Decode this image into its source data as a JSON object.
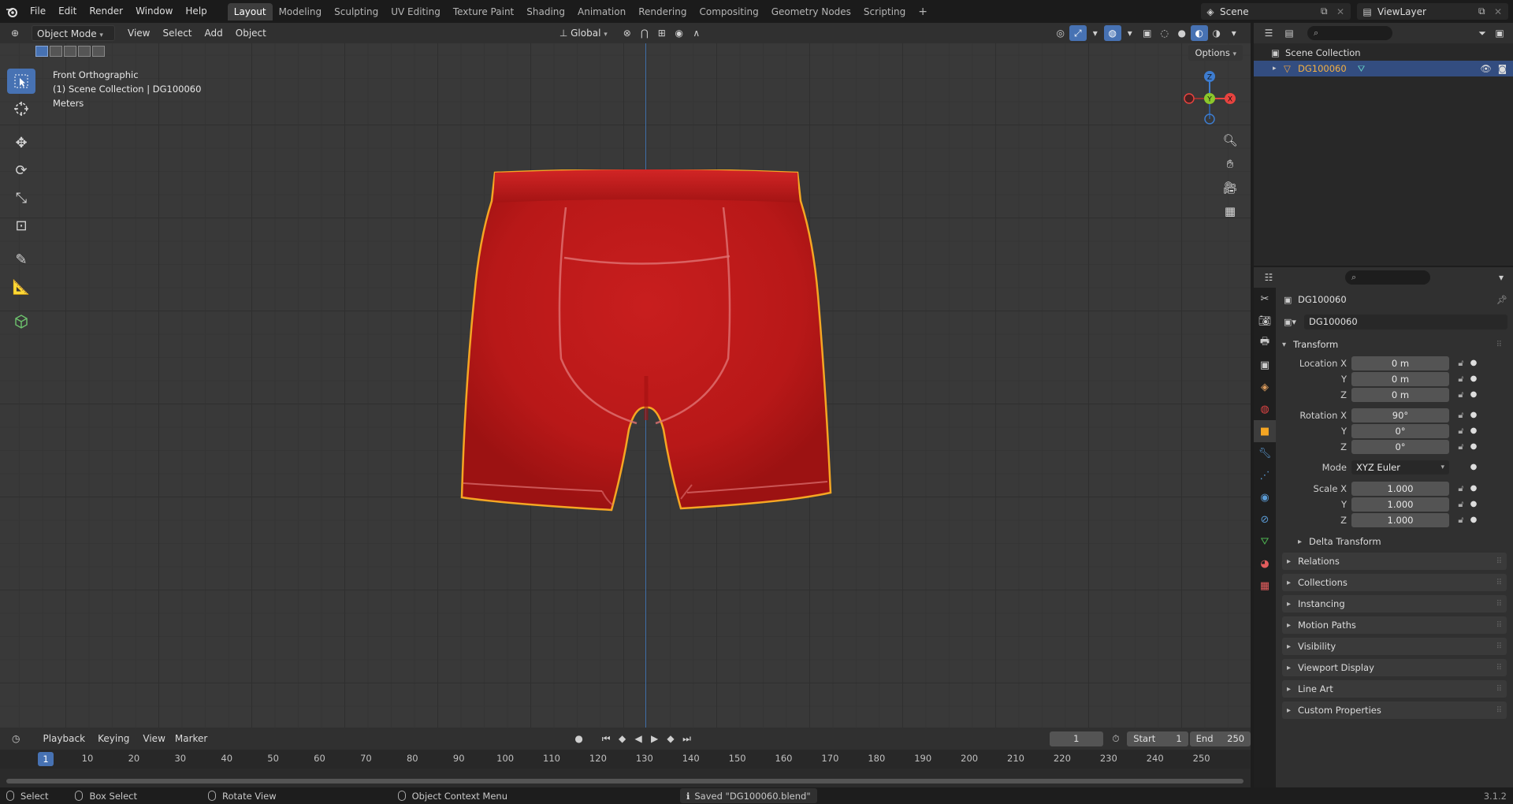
{
  "menu": [
    "File",
    "Edit",
    "Render",
    "Window",
    "Help"
  ],
  "workspaces": [
    "Layout",
    "Modeling",
    "Sculpting",
    "UV Editing",
    "Texture Paint",
    "Shading",
    "Animation",
    "Rendering",
    "Compositing",
    "Geometry Nodes",
    "Scripting"
  ],
  "active_workspace": "Layout",
  "scene": {
    "name": "Scene"
  },
  "view_layer": {
    "name": "ViewLayer"
  },
  "viewport_header": {
    "mode": "Object Mode",
    "menus": [
      "View",
      "Select",
      "Add",
      "Object"
    ],
    "orientation": "Global",
    "options": "Options"
  },
  "viewport_info": {
    "view": "Front Orthographic",
    "collection": "(1) Scene Collection | DG100060",
    "units": "Meters"
  },
  "gizmo": {
    "z": "Z",
    "y": "Y",
    "x": "X"
  },
  "outliner": {
    "root": "Scene Collection",
    "object": "DG100060"
  },
  "properties": {
    "object_name": "DG100060",
    "data_name": "DG100060",
    "transform_title": "Transform",
    "location": {
      "label": "Location X",
      "x": "0 m",
      "y": "0 m",
      "z": "0 m"
    },
    "rotation": {
      "label": "Rotation X",
      "x": "90°",
      "y": "0°",
      "z": "0°"
    },
    "mode_label": "Mode",
    "mode_value": "XYZ Euler",
    "scale": {
      "label": "Scale X",
      "x": "1.000",
      "y": "1.000",
      "z": "1.000"
    },
    "axis_y": "Y",
    "axis_z": "Z",
    "delta": "Delta Transform",
    "panels": [
      "Relations",
      "Collections",
      "Instancing",
      "Motion Paths",
      "Visibility",
      "Viewport Display",
      "Line Art",
      "Custom Properties"
    ]
  },
  "timeline": {
    "menus": [
      "Playback",
      "Keying",
      "View",
      "Marker"
    ],
    "current_frame": "1",
    "start_label": "Start",
    "start": "1",
    "end_label": "End",
    "end": "250",
    "ticks": [
      "1",
      "10",
      "20",
      "30",
      "40",
      "50",
      "60",
      "70",
      "80",
      "90",
      "100",
      "110",
      "120",
      "130",
      "140",
      "150",
      "160",
      "170",
      "180",
      "190",
      "200",
      "210",
      "220",
      "230",
      "240",
      "250"
    ]
  },
  "statusbar": {
    "select": "Select",
    "box_select": "Box Select",
    "rotate_view": "Rotate View",
    "context_menu": "Object Context Menu",
    "message": "Saved \"DG100060.blend\"",
    "version": "3.1.2"
  },
  "colors": {
    "accent": "#4772b3",
    "mesh": "#c8191b",
    "outline": "#f5a623",
    "x_axis": "#e8433f",
    "y_axis": "#8bc72b",
    "z_axis": "#3d7ccf"
  }
}
